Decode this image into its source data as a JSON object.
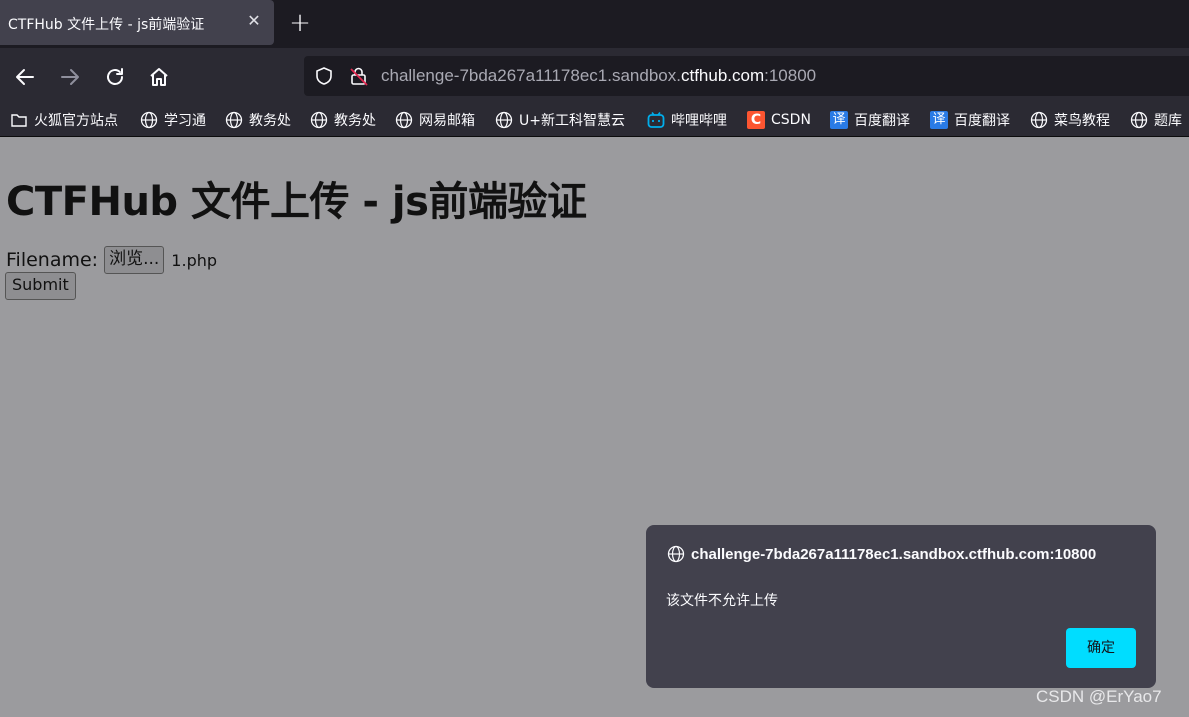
{
  "tab": {
    "title": "CTFHub 文件上传 - js前端验证",
    "close": "✕"
  },
  "newtab": "+",
  "urlbar": {
    "prefix": "challenge-7bda267a11178ec1.sandbox.",
    "host": "ctfhub.com",
    "suffix": ":10800"
  },
  "bookmarks": [
    {
      "label": "火狐官方站点",
      "icon": "folder-icon"
    },
    {
      "label": "学习通",
      "icon": "globe-icon"
    },
    {
      "label": "教务处",
      "icon": "globe-icon"
    },
    {
      "label": "教务处",
      "icon": "globe-icon"
    },
    {
      "label": "网易邮箱",
      "icon": "globe-icon"
    },
    {
      "label": "U+新工科智慧云",
      "icon": "globe-icon"
    },
    {
      "label": "哔哩哔哩",
      "icon": "bilibili-icon"
    },
    {
      "label": "CSDN",
      "icon": "csdn-icon",
      "glyph": "C"
    },
    {
      "label": "百度翻译",
      "icon": "translate-icon",
      "glyph": "译"
    },
    {
      "label": "百度翻译",
      "icon": "translate-icon",
      "glyph": "译"
    },
    {
      "label": "菜鸟教程",
      "icon": "globe-icon"
    },
    {
      "label": "题库",
      "icon": "globe-icon"
    }
  ],
  "page": {
    "title": "CTFHub 文件上传 - js前端验证",
    "filename_label": "Filename:",
    "browse_label": "浏览...",
    "selected_file": "1.php",
    "submit_label": "Submit"
  },
  "dialog": {
    "origin": "challenge-7bda267a11178ec1.sandbox.ctfhub.com:10800",
    "message": "该文件不允许上传",
    "ok_label": "确定"
  },
  "watermark": "CSDN @ErYao7",
  "colors": {
    "accent": "#00ddff",
    "dialog_bg": "#42414d",
    "toolbar_bg": "#2b2a33",
    "page_bg": "#9b9b9e"
  }
}
